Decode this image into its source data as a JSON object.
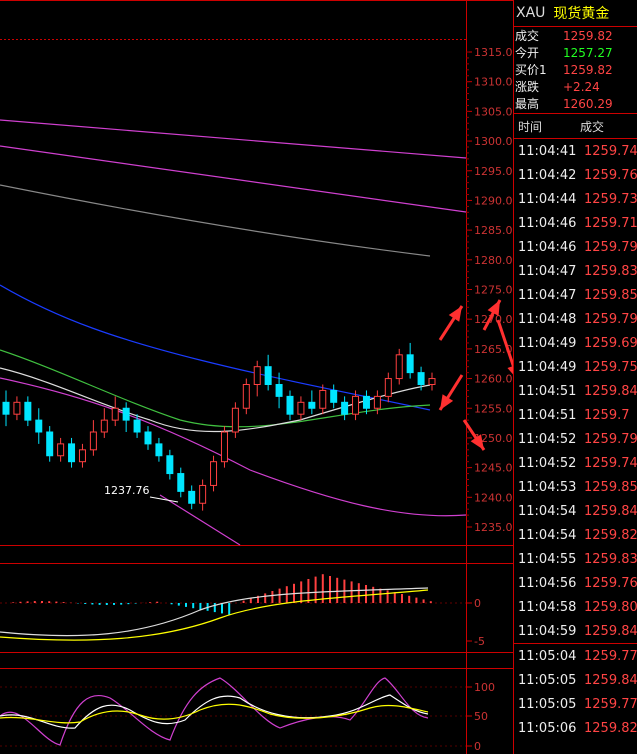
{
  "header": {
    "symbol": "XAU",
    "name": "现货黄金"
  },
  "quote": [
    {
      "label": "成交",
      "value": "1259.82",
      "color": "red"
    },
    {
      "label": "今开",
      "value": "1257.27",
      "color": "green"
    },
    {
      "label": "买价1",
      "value": "1259.82",
      "color": "red"
    },
    {
      "label": "涨跌",
      "value": "+2.24",
      "color": "red"
    },
    {
      "label": "最高",
      "value": "1260.29",
      "color": "red"
    }
  ],
  "trades_header": {
    "time": "时间",
    "price": "成交"
  },
  "trades": [
    {
      "time": "11:04:41",
      "price": "1259.74"
    },
    {
      "time": "11:04:42",
      "price": "1259.76"
    },
    {
      "time": "11:04:44",
      "price": "1259.73"
    },
    {
      "time": "11:04:46",
      "price": "1259.71"
    },
    {
      "time": "11:04:46",
      "price": "1259.79"
    },
    {
      "time": "11:04:47",
      "price": "1259.83"
    },
    {
      "time": "11:04:47",
      "price": "1259.85"
    },
    {
      "time": "11:04:48",
      "price": "1259.79"
    },
    {
      "time": "11:04:49",
      "price": "1259.69"
    },
    {
      "time": "11:04:49",
      "price": "1259.75"
    },
    {
      "time": "11:04:51",
      "price": "1259.84"
    },
    {
      "time": "11:04:51",
      "price": "1259.7"
    },
    {
      "time": "11:04:52",
      "price": "1259.79"
    },
    {
      "time": "11:04:52",
      "price": "1259.74"
    },
    {
      "time": "11:04:53",
      "price": "1259.85"
    },
    {
      "time": "11:04:54",
      "price": "1259.84"
    },
    {
      "time": "11:04:54",
      "price": "1259.82"
    },
    {
      "time": "11:04:55",
      "price": "1259.83"
    },
    {
      "time": "11:04:56",
      "price": "1259.76"
    },
    {
      "time": "11:04:58",
      "price": "1259.80"
    },
    {
      "time": "11:04:59",
      "price": "1259.84"
    }
  ],
  "trades2": [
    {
      "time": "11:05:04",
      "price": "1259.77"
    },
    {
      "time": "11:05:05",
      "price": "1259.84"
    },
    {
      "time": "11:05:05",
      "price": "1259.77"
    },
    {
      "time": "11:05:06",
      "price": "1259.82"
    }
  ],
  "chart_data": {
    "type": "candlestick",
    "price_axis": {
      "range": [
        1233,
        1317
      ],
      "ticks": [
        "1315.0",
        "1310.0",
        "1305.0",
        "1300.0",
        "1295.0",
        "1290.0",
        "1285.0",
        "1280.0",
        "1275.0",
        "1270.0",
        "1265.0",
        "1260.0",
        "1255.0",
        "1250.0",
        "1245.0",
        "1240.0",
        "1235.0"
      ]
    },
    "low_annotation": "1237.76",
    "candles": [
      [
        1256,
        1254,
        1258,
        1252
      ],
      [
        1254,
        1256,
        1257,
        1253
      ],
      [
        1256,
        1253,
        1257,
        1252
      ],
      [
        1253,
        1251,
        1255,
        1249
      ],
      [
        1251,
        1247,
        1252,
        1246
      ],
      [
        1247,
        1249,
        1250,
        1246
      ],
      [
        1249,
        1246,
        1250,
        1245
      ],
      [
        1246,
        1248,
        1249,
        1245
      ],
      [
        1248,
        1251,
        1253,
        1247
      ],
      [
        1251,
        1253,
        1255,
        1250
      ],
      [
        1253,
        1255,
        1257,
        1252
      ],
      [
        1255,
        1253,
        1256,
        1251
      ],
      [
        1253,
        1251,
        1254,
        1250
      ],
      [
        1251,
        1249,
        1252,
        1248
      ],
      [
        1249,
        1247,
        1250,
        1246
      ],
      [
        1247,
        1244,
        1248,
        1243
      ],
      [
        1244,
        1241,
        1245,
        1240
      ],
      [
        1241,
        1239,
        1242,
        1238
      ],
      [
        1239,
        1242,
        1243,
        1237.76
      ],
      [
        1242,
        1246,
        1247,
        1241
      ],
      [
        1246,
        1251,
        1252,
        1245
      ],
      [
        1251,
        1255,
        1256,
        1250
      ],
      [
        1255,
        1259,
        1260,
        1254
      ],
      [
        1259,
        1262,
        1263,
        1257
      ],
      [
        1262,
        1259,
        1264,
        1258
      ],
      [
        1259,
        1257,
        1261,
        1255
      ],
      [
        1257,
        1254,
        1258,
        1253
      ],
      [
        1254,
        1256,
        1257,
        1253
      ],
      [
        1256,
        1255,
        1258,
        1254
      ],
      [
        1255,
        1258,
        1259,
        1254
      ],
      [
        1258,
        1256,
        1259,
        1255
      ],
      [
        1256,
        1254,
        1257,
        1253
      ],
      [
        1254,
        1257,
        1258,
        1253
      ],
      [
        1257,
        1255,
        1258,
        1254
      ],
      [
        1255,
        1257,
        1258,
        1254
      ],
      [
        1257,
        1260,
        1261,
        1256
      ],
      [
        1260,
        1264,
        1265,
        1259
      ],
      [
        1264,
        1261,
        1266,
        1260
      ],
      [
        1261,
        1259,
        1262,
        1258
      ],
      [
        1259,
        1260,
        1261,
        1258
      ]
    ],
    "macd_axis": {
      "ticks": [
        "0",
        "-5"
      ],
      "range": [
        -6,
        7
      ]
    },
    "kdj_axis": {
      "ticks": [
        "100",
        "50",
        "0"
      ],
      "range": [
        0,
        110
      ]
    },
    "colors": {
      "up": "#ff4040",
      "down": "#00e5ff"
    }
  }
}
